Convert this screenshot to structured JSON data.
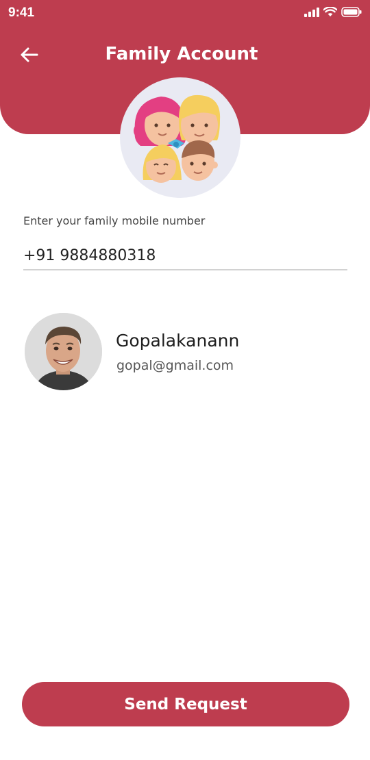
{
  "status_bar": {
    "time": "9:41",
    "icons": [
      "cellular-signal-icon",
      "wifi-icon",
      "battery-icon"
    ]
  },
  "header": {
    "back_icon": "arrow-left-icon",
    "title": "Family Account"
  },
  "form": {
    "label": "Enter your family mobile number",
    "phone_value": "+91 9884880318"
  },
  "contact": {
    "name": "Gopalakanann",
    "email": "gopal@gmail.com"
  },
  "actions": {
    "send_label": "Send Request"
  },
  "colors": {
    "primary": "#be3d4f",
    "avatar_bg": "#e9eaf3",
    "divider": "#d2d2d2"
  }
}
